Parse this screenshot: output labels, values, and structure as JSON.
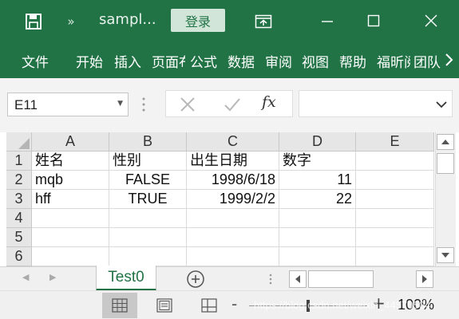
{
  "title_bar": {
    "document_title": "sampl...",
    "login_label": "登录",
    "overflow_glyph": "»",
    "icons": [
      "save-icon",
      "ribbon-display-options-icon",
      "minimize-icon",
      "maximize-icon",
      "close-icon"
    ]
  },
  "ribbon": {
    "tabs": [
      {
        "label": "文件"
      },
      {
        "label": "开始"
      },
      {
        "label": "插入"
      },
      {
        "label": "页面布局"
      },
      {
        "label": "公式"
      },
      {
        "label": "数据"
      },
      {
        "label": "审阅"
      },
      {
        "label": "视图"
      },
      {
        "label": "帮助"
      },
      {
        "label": "福昕阅读器"
      },
      {
        "label": "团队"
      }
    ]
  },
  "formula_bar": {
    "name_box_value": "E11",
    "function_label": "fx",
    "formula_value": ""
  },
  "grid": {
    "columns": [
      "A",
      "B",
      "C",
      "D",
      "E"
    ],
    "rows": [
      "1",
      "2",
      "3",
      "4",
      "5",
      "6"
    ],
    "cells": [
      [
        "姓名",
        "性别",
        "出生日期",
        "数字",
        ""
      ],
      [
        "mqb",
        "FALSE",
        "1998/6/18",
        "11",
        ""
      ],
      [
        "hff",
        "TRUE",
        "1999/2/2",
        "22",
        ""
      ],
      [
        "",
        "",
        "",
        "",
        ""
      ],
      [
        "",
        "",
        "",
        "",
        ""
      ],
      [
        "",
        "",
        "",
        "",
        ""
      ]
    ]
  },
  "sheets": {
    "tabs": [
      {
        "label": "Test0",
        "active": true
      }
    ],
    "add_glyph": "+"
  },
  "status_bar": {
    "zoom_level": "100%",
    "zoom_minus": "-",
    "zoom_plus": "+",
    "watermark_text": "https://blog.csdn.net/weixin_44570504"
  },
  "colors": {
    "brand": "#217346",
    "login_button_bg": "#d2e5d9",
    "chrome_bg": "#f3f3f3",
    "header_bg": "#e6e6e6"
  }
}
